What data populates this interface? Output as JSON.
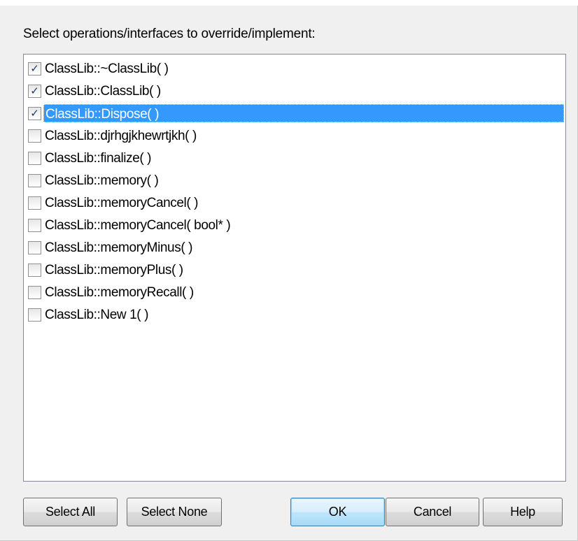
{
  "dialog": {
    "prompt": "Select operations/interfaces to override/implement:"
  },
  "operations": [
    {
      "label": "ClassLib::~ClassLib( )",
      "checked": true,
      "selected": false
    },
    {
      "label": "ClassLib::ClassLib( )",
      "checked": true,
      "selected": false
    },
    {
      "label": "ClassLib::Dispose( )",
      "checked": true,
      "selected": true
    },
    {
      "label": "ClassLib::djrhgjkhewrtjkh( )",
      "checked": false,
      "selected": false
    },
    {
      "label": "ClassLib::finalize( )",
      "checked": false,
      "selected": false
    },
    {
      "label": "ClassLib::memory( )",
      "checked": false,
      "selected": false
    },
    {
      "label": "ClassLib::memoryCancel( )",
      "checked": false,
      "selected": false
    },
    {
      "label": "ClassLib::memoryCancel( bool* )",
      "checked": false,
      "selected": false
    },
    {
      "label": "ClassLib::memoryMinus( )",
      "checked": false,
      "selected": false
    },
    {
      "label": "ClassLib::memoryPlus( )",
      "checked": false,
      "selected": false
    },
    {
      "label": "ClassLib::memoryRecall( )",
      "checked": false,
      "selected": false
    },
    {
      "label": "ClassLib::New 1( )",
      "checked": false,
      "selected": false
    }
  ],
  "buttons": {
    "select_all": "Select All",
    "select_none": "Select None",
    "ok": "OK",
    "cancel": "Cancel",
    "help": "Help"
  },
  "colors": {
    "selection": "#3399ff",
    "dialog_background": "#f0f0f0",
    "checkmark": "#1e3a6e"
  }
}
